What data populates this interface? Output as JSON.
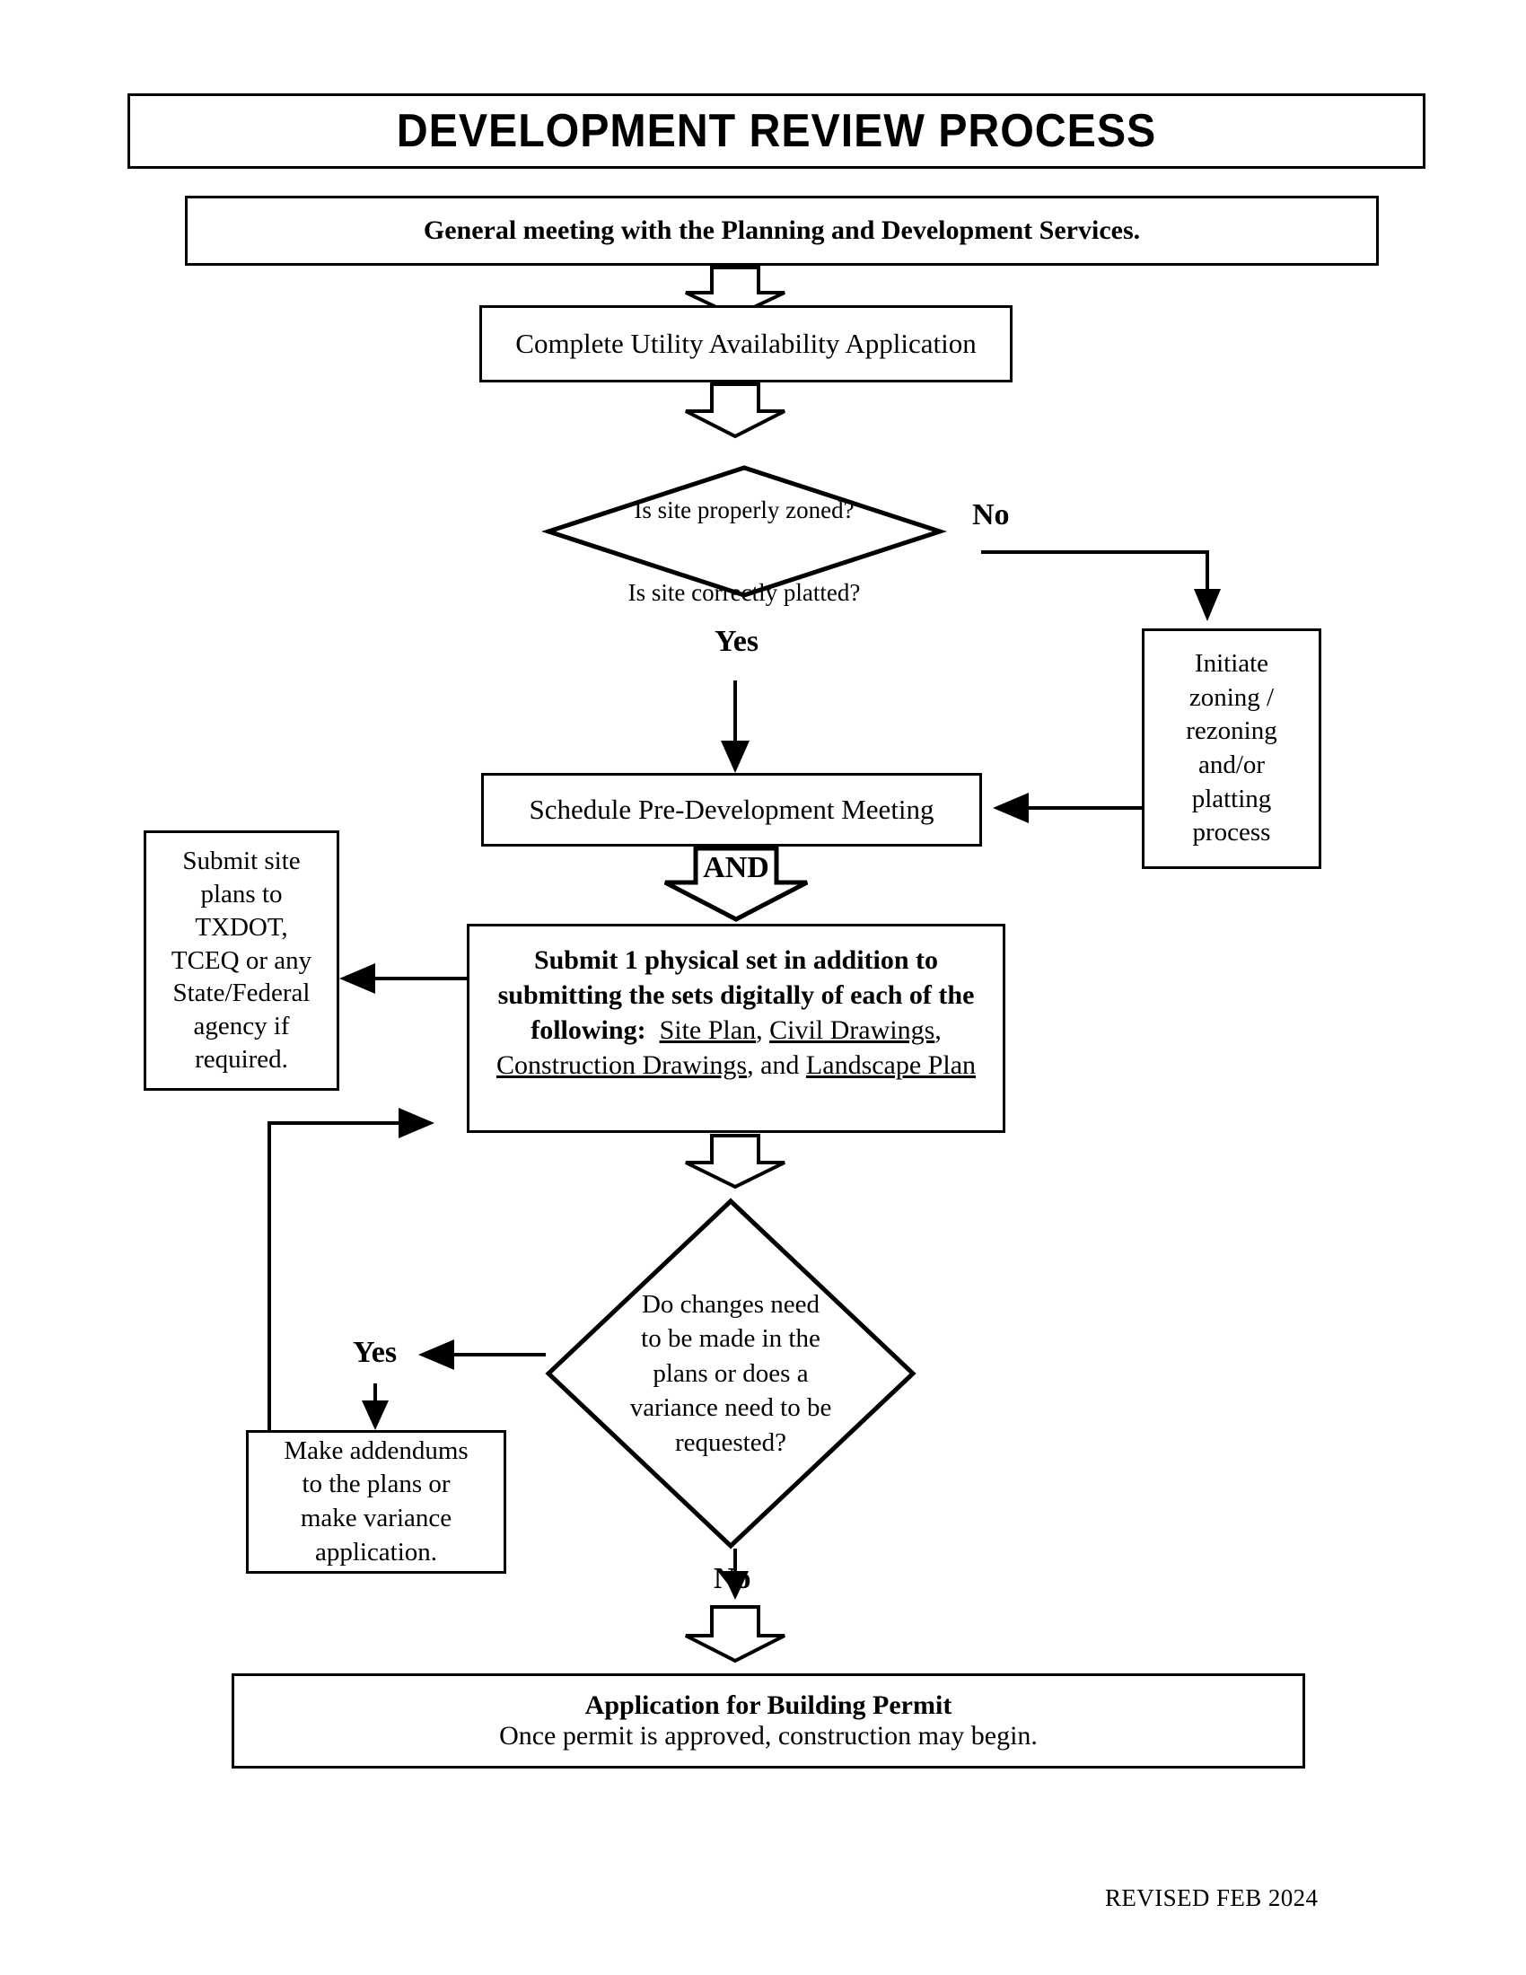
{
  "document": {
    "title": "DEVELOPMENT REVIEW PROCESS",
    "footer": "REVISED FEB 2024"
  },
  "flowchart": {
    "type": "flowchart",
    "orientation": "top-to-bottom",
    "nodes": {
      "title": {
        "shape": "rectangle",
        "label": "DEVELOPMENT REVIEW PROCESS"
      },
      "general_meeting": {
        "shape": "rectangle",
        "label": "General meeting with the Planning and Development Services."
      },
      "utility_application": {
        "shape": "rectangle",
        "label": "Complete Utility Availability Application"
      },
      "decision_zoned": {
        "shape": "diamond",
        "line1": "Is site properly zoned?",
        "line2": "Is site correctly platted?"
      },
      "initiate_zoning": {
        "shape": "rectangle",
        "label": "Initiate\nzoning /\nrezoning\nand/or\nplatting\nprocess"
      },
      "schedule_meeting": {
        "shape": "rectangle",
        "label": "Schedule Pre-Development Meeting"
      },
      "txdot_submittal": {
        "shape": "rectangle",
        "label": "Submit site\nplans to\nTXDOT,\nTCEQ or any\nState/Federal\nagency if\nrequired."
      },
      "submit_sets": {
        "shape": "rectangle",
        "bold_lead": "Submit 1 physical set in addition to submitting the sets digitally of each of the following:",
        "items": [
          "Site Plan",
          "Civil Drawings",
          "Construction Drawings",
          "Landscape Plan"
        ],
        "separator_1": ", ",
        "separator_2": ", ",
        "connector_and": ", and ",
        "trailing": ""
      },
      "decision_changes": {
        "shape": "diamond",
        "label": "Do  changes need\nto be made in the\nplans or does a\nvariance need to be\nrequested?"
      },
      "make_addendums": {
        "shape": "rectangle",
        "label": "Make addendums\nto the plans or\nmake variance\napplication."
      },
      "building_permit": {
        "shape": "rectangle",
        "line1": "Application for Building Permit",
        "line2": "Once permit is approved, construction may begin."
      }
    },
    "connectors": {
      "and_gate_label": "AND",
      "branch_labels": {
        "zoned_no": "No",
        "zoned_yes": "Yes",
        "changes_yes": "Yes",
        "changes_no": "No"
      }
    }
  }
}
